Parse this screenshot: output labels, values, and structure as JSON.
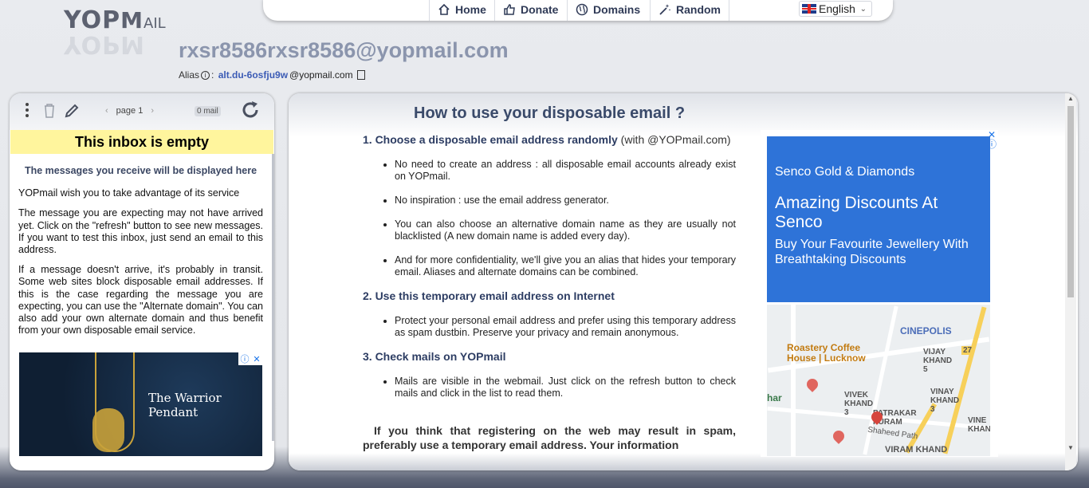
{
  "logo": {
    "text_yop": "YOP",
    "text_m": "M",
    "text_ail": "AIL"
  },
  "nav": {
    "home": "Home",
    "donate": "Donate",
    "domains": "Domains",
    "random": "Random",
    "language": "English"
  },
  "inbox": {
    "email": "rxsr8586rxsr8586@yopmail.com",
    "alias_label": "Alias",
    "alias_address": "alt.du-6osfju9w",
    "alias_domain": "@yopmail.com"
  },
  "left_panel": {
    "page_label": "page 1",
    "mail_count": "0 mail",
    "empty_banner": "This inbox is empty",
    "subtitle": "The messages you receive will be displayed here",
    "p1": "YOPmail wish you to take advantage of its service",
    "p2": "The message you are expecting may not have arrived yet. Click on the \"refresh\" button to see new messages. If you want to test this inbox, just send an email to this address.",
    "p3": "If a message doesn't arrive, it's probably in transit. Some web sites block disposable email addresses. If this is the case regarding the message you are expecting, you can use the \"Alternate domain\". You can also add your own alternate domain and thus benefit from your own disposable email service.",
    "ad_text_1": "The Warrior",
    "ad_text_2": "Pendant"
  },
  "help": {
    "title": "How to use your disposable email ?",
    "s1_title": "1. Choose a disposable email address randomly",
    "s1_suffix": "(with @YOPmail.com)",
    "s1_items": [
      "No need to create an address : all disposable email accounts already exist on YOPmail.",
      "No inspiration : use the email address generator.",
      "You can also choose an alternative domain name as they are usually not blacklisted (A new domain name is added every day).",
      "And for more confidentiality, we'll give you an alias that hides your temporary email. Aliases and alternate domains can be combined."
    ],
    "s2_title": "2. Use this temporary email address on Internet",
    "s2_items": [
      "Protect your personal email address and prefer using this temporary address as spam dustbin. Preserve your privacy and remain anonymous."
    ],
    "s3_title": "3. Check mails on YOPmail",
    "s3_items": [
      "Mails are visible in the webmail. Just click on the refresh button to check mails and click in the list to read them."
    ],
    "spam_note": "If you think that registering on the web may result in spam, preferably use a temporary email address. Your information"
  },
  "ad_right": {
    "brand": "Senco Gold & Diamonds",
    "headline": "Amazing Discounts At Senco",
    "desc": "Buy Your Favourite Jewellery With Breathtaking Discounts",
    "map_labels": {
      "cinepolis": "CINEPOLIS",
      "roastery": "Roastery Coffee House | Lucknow",
      "vijay": "VIJAY KHAND 5",
      "vinay": "VINAY KHAND 3",
      "vivek": "VIVEK KHAND 3",
      "patrakar": "PATRAKAR PURAM",
      "shaheed": "Shaheed Path",
      "viram": "VIRAM KHAND",
      "char": "har",
      "vine": "VINE KHAN",
      "num27": "27"
    }
  }
}
